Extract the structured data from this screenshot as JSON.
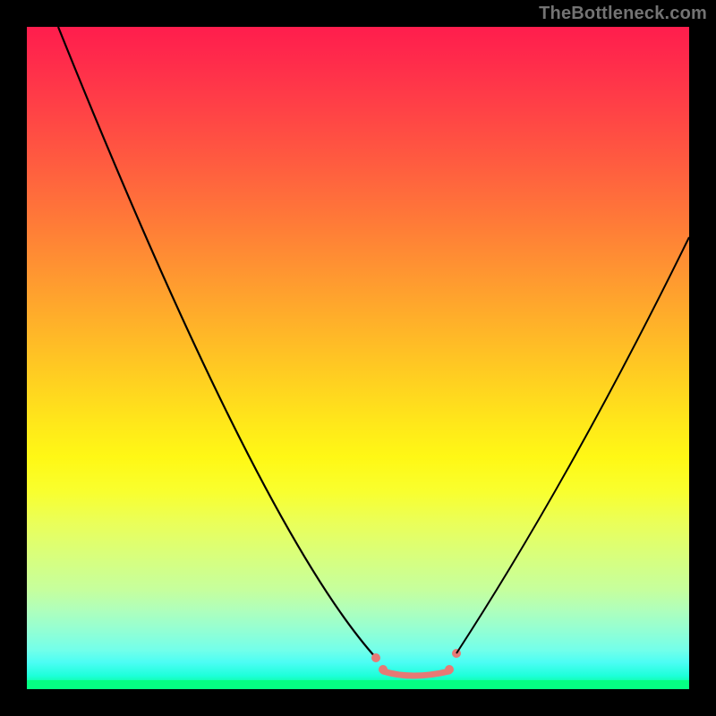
{
  "watermark": "TheBottleneck.com",
  "chart_data": {
    "type": "line",
    "title": "",
    "xlabel": "",
    "ylabel": "",
    "xlim": [
      0,
      100
    ],
    "ylim": [
      0,
      100
    ],
    "background_gradient": {
      "direction": "vertical",
      "stops": [
        {
          "pos": 0.0,
          "color": "#ff1d4d"
        },
        {
          "pos": 0.25,
          "color": "#ff6b3c"
        },
        {
          "pos": 0.5,
          "color": "#ffc424"
        },
        {
          "pos": 0.75,
          "color": "#eaff5a"
        },
        {
          "pos": 0.95,
          "color": "#4bfdf4"
        },
        {
          "pos": 1.0,
          "color": "#05ff83"
        }
      ]
    },
    "series": [
      {
        "name": "main-curve",
        "color": "#000000",
        "x": [
          5,
          10,
          15,
          20,
          25,
          30,
          35,
          40,
          45,
          50,
          53,
          55,
          60,
          63,
          65,
          70,
          75,
          80,
          85,
          90,
          95,
          100
        ],
        "y": [
          100,
          87,
          75,
          64,
          54,
          45,
          37,
          29,
          22,
          15,
          8,
          3,
          1.5,
          1.5,
          3,
          10,
          20,
          31,
          43,
          55,
          62,
          68
        ]
      }
    ],
    "markers": {
      "color": "#e77975",
      "points": [
        {
          "x": 53,
          "y": 5
        },
        {
          "x": 54,
          "y": 2.8
        },
        {
          "x": 63,
          "y": 2.8
        },
        {
          "x": 65,
          "y": 5.5
        }
      ]
    }
  }
}
